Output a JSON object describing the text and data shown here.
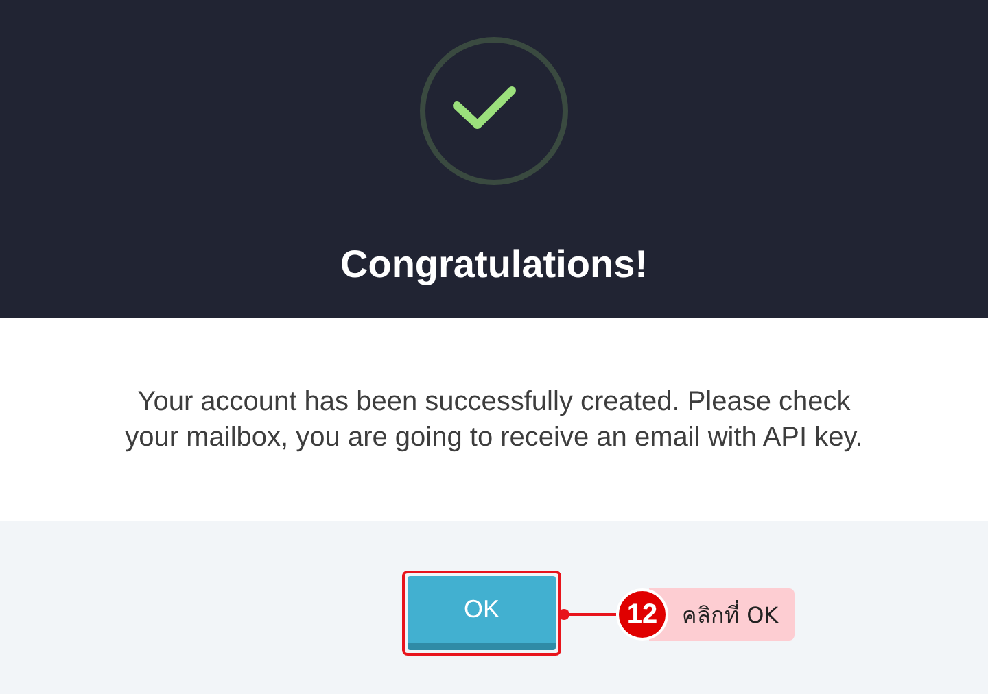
{
  "header": {
    "title": "Congratulations!"
  },
  "message": "Your account has been successfully created. Please check your mailbox, you are going to receive an email with API key.",
  "buttons": [
    {
      "label": "OK"
    }
  ],
  "annotation": {
    "step": "12",
    "text": "คลิกที่ OK"
  }
}
